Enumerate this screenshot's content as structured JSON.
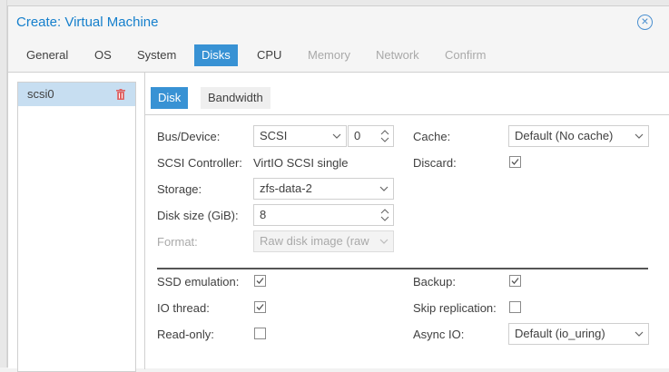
{
  "window": {
    "title": "Create: Virtual Machine"
  },
  "tabs": [
    {
      "label": "General",
      "state": "normal"
    },
    {
      "label": "OS",
      "state": "normal"
    },
    {
      "label": "System",
      "state": "normal"
    },
    {
      "label": "Disks",
      "state": "active"
    },
    {
      "label": "CPU",
      "state": "normal"
    },
    {
      "label": "Memory",
      "state": "disabled"
    },
    {
      "label": "Network",
      "state": "disabled"
    },
    {
      "label": "Confirm",
      "state": "disabled"
    }
  ],
  "disk_list": {
    "items": [
      {
        "label": "scsi0"
      }
    ]
  },
  "subtabs": {
    "disk": "Disk",
    "bandwidth": "Bandwidth"
  },
  "form": {
    "bus_device": {
      "label": "Bus/Device:",
      "bus": "SCSI",
      "device": "0"
    },
    "scsi_controller": {
      "label": "SCSI Controller:",
      "value": "VirtIO SCSI single"
    },
    "storage": {
      "label": "Storage:",
      "value": "zfs-data-2"
    },
    "disk_size": {
      "label": "Disk size (GiB):",
      "value": "8"
    },
    "format": {
      "label": "Format:",
      "value": "Raw disk image (raw"
    },
    "cache": {
      "label": "Cache:",
      "value": "Default (No cache)"
    },
    "discard": {
      "label": "Discard:",
      "checked": true
    },
    "ssd_emulation": {
      "label": "SSD emulation:",
      "checked": true
    },
    "io_thread": {
      "label": "IO thread:",
      "checked": true
    },
    "read_only": {
      "label": "Read-only:",
      "checked": false
    },
    "backup": {
      "label": "Backup:",
      "checked": true
    },
    "skip_replication": {
      "label": "Skip replication:",
      "checked": false
    },
    "async_io": {
      "label": "Async IO:",
      "value": "Default (io_uring)"
    }
  },
  "colors": {
    "accent": "#3892d4",
    "title": "#157fcc",
    "selection": "#c7def1",
    "trash": "#e06060"
  }
}
